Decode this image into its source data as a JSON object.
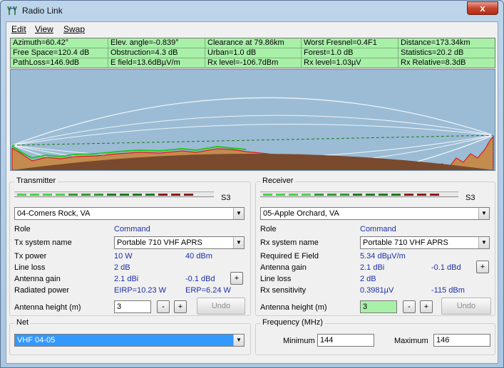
{
  "window": {
    "title": "Radio Link",
    "close_glyph": "x"
  },
  "menu": {
    "items": [
      "Edit",
      "View",
      "Swap"
    ]
  },
  "info": {
    "rows": [
      [
        "Azimuth=60.42°",
        "Elev. angle=-0.839°",
        "Clearance at 79.86km",
        "Worst Fresnel=0.4F1",
        "Distance=173.34km"
      ],
      [
        "Free Space=120.4 dB",
        "Obstruction=4.3 dB",
        "Urban=1.0 dB",
        "Forest=1.0 dB",
        "Statistics=20.2 dB"
      ],
      [
        "PathLoss=146.9dB",
        "E field=13.6dBµV/m",
        "Rx level=-106.7dBm",
        "Rx level=1.03µV",
        "Rx Relative=8.3dB"
      ]
    ]
  },
  "colors": {
    "sky": "#9bbcd4",
    "ground": "#c48b4f",
    "earth_curve": "#7a4a2e",
    "terrain_line": "#e01818",
    "vegetation": "#1ec81e",
    "los_line": "#1a7a1a",
    "info_bg": "#a8f0a8",
    "value_text": "#1b2fa8"
  },
  "transmitter": {
    "title": "Transmitter",
    "signal_label": "S3",
    "site": "04-Comers Rock, VA",
    "role_label": "Role",
    "role_value": "Command",
    "system_label": "Tx system name",
    "system_value": "Portable 710 VHF APRS",
    "power_label": "Tx power",
    "power_w": "10 W",
    "power_dbm": "40 dBm",
    "lineloss_label": "Line loss",
    "lineloss_value": "2 dB",
    "gain_label": "Antenna gain",
    "gain_dbi": "2.1 dBi",
    "gain_dbd": "-0.1 dBd",
    "radiated_label": "Radiated power",
    "eirp": "EIRP=10.23 W",
    "erp": "ERP=6.24 W",
    "height_label": "Antenna height (m)",
    "height_value": "3",
    "minus": "-",
    "plus": "+",
    "undo": "Undo"
  },
  "receiver": {
    "title": "Receiver",
    "signal_label": "S3",
    "site": "05-Apple Orchard, VA",
    "role_label": "Role",
    "role_value": "Command",
    "system_label": "Rx system name",
    "system_value": "Portable 710 VHF APRS",
    "field_label": "Required E Field",
    "field_value": "5.34 dBµV/m",
    "gain_label": "Antenna gain",
    "gain_dbi": "2.1 dBi",
    "gain_dbd": "-0.1 dBd",
    "lineloss_label": "Line loss",
    "lineloss_value": "2 dB",
    "sens_label": "Rx sensitivity",
    "sens_uv": "0.3981µV",
    "sens_dbm": "-115 dBm",
    "height_label": "Antenna height (m)",
    "height_value": "3",
    "minus": "-",
    "plus": "+",
    "undo": "Undo"
  },
  "net": {
    "title": "Net",
    "value": "VHF 04-05"
  },
  "frequency": {
    "title": "Frequency (MHz)",
    "min_label": "Minimum",
    "min_value": "144",
    "max_label": "Maximum",
    "max_value": "146"
  }
}
